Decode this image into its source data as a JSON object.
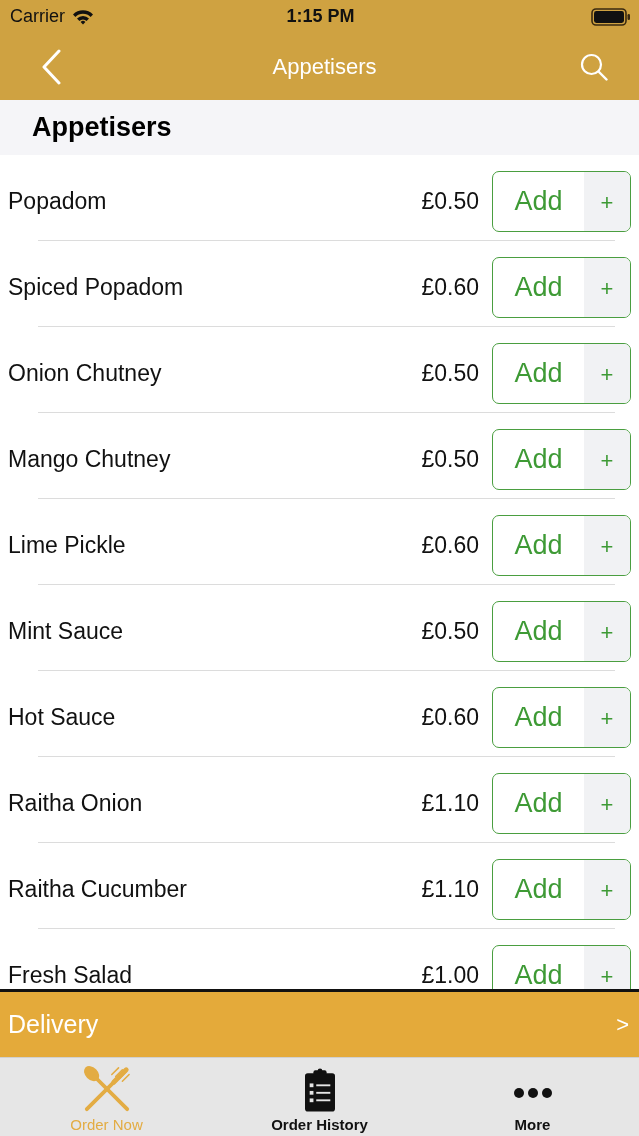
{
  "status_bar": {
    "carrier": "Carrier",
    "time": "1:15 PM"
  },
  "nav_bar": {
    "title": "Appetisers"
  },
  "section": {
    "title": "Appetisers"
  },
  "items": [
    {
      "name": "Popadom",
      "price": "£0.50",
      "button": "Add",
      "plus": "+"
    },
    {
      "name": "Spiced Popadom",
      "price": "£0.60",
      "button": "Add",
      "plus": "+"
    },
    {
      "name": "Onion Chutney",
      "price": "£0.50",
      "button": "Add",
      "plus": "+"
    },
    {
      "name": "Mango Chutney",
      "price": "£0.50",
      "button": "Add",
      "plus": "+"
    },
    {
      "name": "Lime Pickle",
      "price": "£0.60",
      "button": "Add",
      "plus": "+"
    },
    {
      "name": "Mint Sauce",
      "price": "£0.50",
      "button": "Add",
      "plus": "+"
    },
    {
      "name": "Hot Sauce",
      "price": "£0.60",
      "button": "Add",
      "plus": "+"
    },
    {
      "name": "Raitha Onion",
      "price": "£1.10",
      "button": "Add",
      "plus": "+"
    },
    {
      "name": "Raitha Cucumber",
      "price": "£1.10",
      "button": "Add",
      "plus": "+"
    },
    {
      "name": "Fresh Salad",
      "price": "£1.00",
      "button": "Add",
      "plus": "+"
    }
  ],
  "delivery_bar": {
    "label": "Delivery",
    "chevron": ">"
  },
  "tab_bar": [
    {
      "label": "Order Now",
      "selected": true
    },
    {
      "label": "Order History",
      "selected": false
    },
    {
      "label": "More",
      "selected": false
    }
  ]
}
